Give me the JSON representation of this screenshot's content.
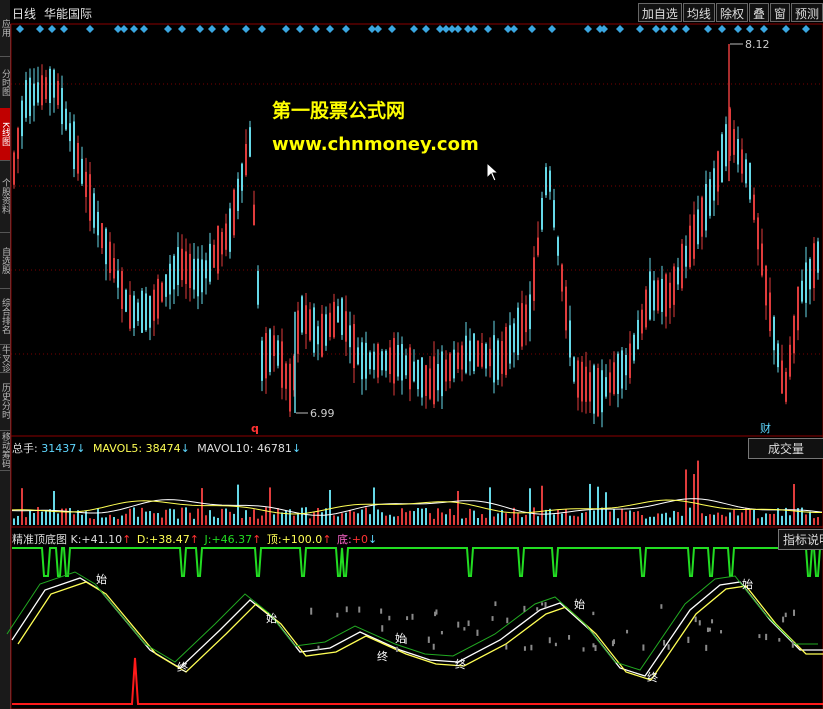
{
  "left_tabs": [
    "应用",
    "分时图",
    "K线图",
    "个股资料",
    "自选股",
    "综合排名",
    "牛叉诊断",
    "历史分时",
    "移动筹码"
  ],
  "title_bar": {
    "period": "日线",
    "stock_name": "华能国际"
  },
  "toolbar": [
    "加自选",
    "均线",
    "除权",
    "叠",
    "窗",
    "预测"
  ],
  "price_chart": {
    "high_label": "8.12",
    "low_label": "6.99",
    "marker_q": "q",
    "marker_cai": "财",
    "watermark_title": "第一股票公式网",
    "watermark_url": "www.chnmoney.com",
    "colors": {
      "up": "#e03c3c",
      "down": "#66d9e8",
      "diamond": "#3aa6e0"
    }
  },
  "volume_panel": {
    "prefix": "总手:",
    "total": "31437",
    "mavol5_label": "MAVOL5:",
    "mavol5": "38474",
    "mavol10_label": "MAVOL10:",
    "mavol10": "46781",
    "arrow": "↓",
    "button": "成交量"
  },
  "indicator_panel": {
    "name": "精准顶底图",
    "k_label": "K:",
    "k": "+41.10",
    "k_arrow": "↑",
    "d_label": "D:",
    "d": "+38.47",
    "d_arrow": "↑",
    "j_label": "J:",
    "j": "+46.37",
    "j_arrow": "↑",
    "top_label": "顶:",
    "top": "+100.0",
    "top_arrow": "↑",
    "bottom_label": "底:",
    "bottom": "+0",
    "bottom_arrow": "↓",
    "button": "指标说明",
    "start_mark": "始",
    "end_mark": "终"
  }
}
